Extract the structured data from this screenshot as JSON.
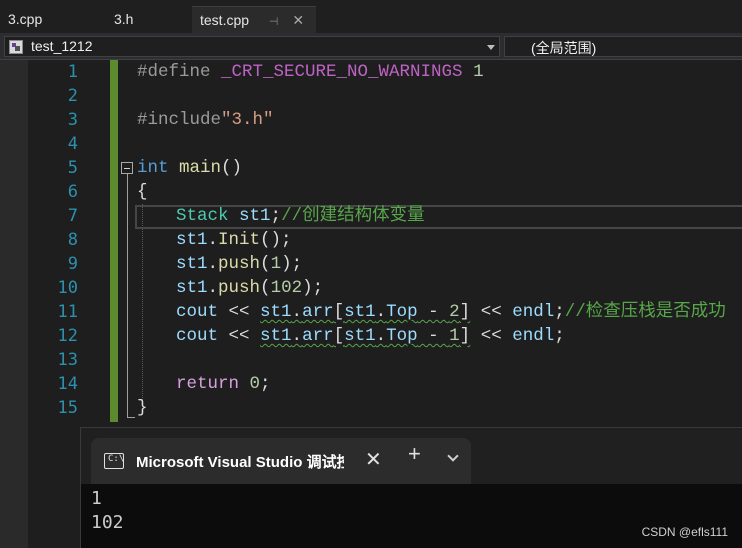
{
  "tabs": [
    {
      "label": "3.cpp",
      "active": false
    },
    {
      "label": "3.h",
      "active": false
    },
    {
      "label": "test.cpp",
      "active": true,
      "pin_icon": "pin-icon",
      "close_icon": "close-icon"
    }
  ],
  "navbar": {
    "project": "test_1212",
    "scope": "(全局范围)",
    "project_icon": "class-view-icon"
  },
  "editor": {
    "line_numbers": [
      "1",
      "2",
      "3",
      "4",
      "5",
      "6",
      "7",
      "8",
      "9",
      "10",
      "11",
      "12",
      "13",
      "14",
      "15"
    ],
    "lines": {
      "l1_directive": "#define ",
      "l1_macro": "_CRT_SECURE_NO_WARNINGS",
      "l1_space": " ",
      "l1_value": "1",
      "l3_directive": "#include",
      "l3_path": "\"3.h\"",
      "l5_type": "int",
      "l5_name": " main",
      "l5_parens": "()",
      "l6_brace": "{",
      "l7_type": "Stack",
      "l7_space": " ",
      "l7_var": "st1",
      "l7_semi": ";",
      "l7_comment": "//创建结构体变量",
      "l8_var": "st1",
      "l8_dot": ".",
      "l8_fn": "Init",
      "l8_rest": "();",
      "l9_var": "st1",
      "l9_dot": ".",
      "l9_fn": "push",
      "l9_open": "(",
      "l9_num": "1",
      "l9_close": ");",
      "l10_var": "st1",
      "l10_dot": ".",
      "l10_fn": "push",
      "l10_open": "(",
      "l10_num": "102",
      "l10_close": ");",
      "l11_cout": "cout",
      "l11_op1": " << ",
      "l11_var1": "st1",
      "l11_dot1": ".",
      "l11_arr": "arr",
      "l11_open": "[",
      "l11_var2": "st1",
      "l11_dot2": ".",
      "l11_top": "Top",
      "l11_minus": " - ",
      "l11_num": "2",
      "l11_close": "]",
      "l11_op2": " << ",
      "l11_endl": "endl",
      "l11_semi": ";",
      "l11_comment": "//检查压栈是否成功",
      "l12_cout": "cout",
      "l12_op1": " << ",
      "l12_var1": "st1",
      "l12_dot1": ".",
      "l12_arr": "arr",
      "l12_open": "[",
      "l12_var2": "st1",
      "l12_dot2": ".",
      "l12_top": "Top",
      "l12_minus": " - ",
      "l12_num": "1",
      "l12_close": "]",
      "l12_op2": " << ",
      "l12_endl": "endl",
      "l12_semi": ";",
      "l14_return": "return",
      "l14_space": " ",
      "l14_num": "0",
      "l14_semi": ";",
      "l15_brace": "}"
    }
  },
  "console": {
    "title": "Microsoft Visual Studio 调试控制台",
    "output": [
      "1",
      "102"
    ],
    "icon": "terminal-icon",
    "close_icon": "close-icon",
    "new_tab_icon": "plus-icon",
    "dropdown_icon": "chevron-down-icon"
  },
  "watermark": "CSDN @efls111",
  "colors": {
    "keyword": "#569cd6",
    "line_number": "#2b91af",
    "comment": "#57a64a",
    "number": "#b5cea8",
    "macro": "#bd63c5",
    "string": "#d69d85",
    "change_margin": "#5c8a2e"
  }
}
